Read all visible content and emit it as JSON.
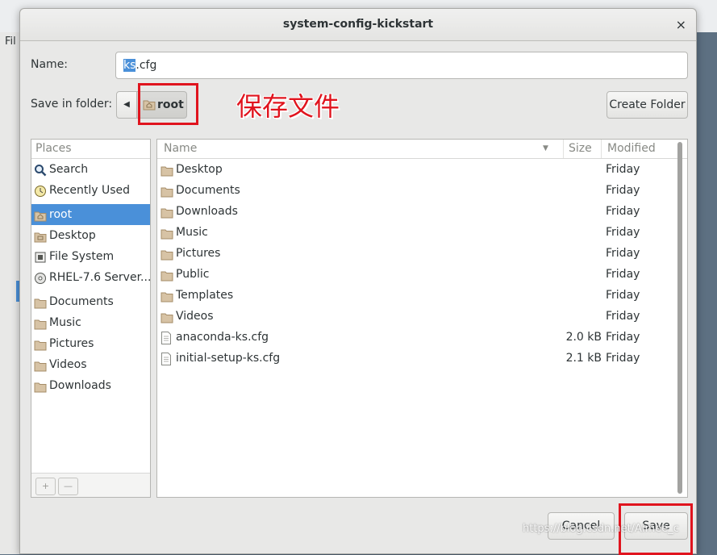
{
  "background": {
    "menu_text": "Fil"
  },
  "window": {
    "title": "system-config-kickstart",
    "close_glyph": "×"
  },
  "name_row": {
    "label": "Name:",
    "value_selected": "ks",
    "value_rest": ".cfg"
  },
  "folder_row": {
    "label": "Save in folder:",
    "back_glyph": "◀",
    "current": "root",
    "annotation": "保存文件",
    "create_folder": "Create Folder"
  },
  "places": {
    "header": "Places",
    "items": [
      {
        "label": "Search",
        "icon": "search-icon"
      },
      {
        "label": "Recently Used",
        "icon": "recent-icon"
      },
      {
        "label": "root",
        "icon": "home-folder-icon",
        "active": true
      },
      {
        "label": "Desktop",
        "icon": "folder-icon"
      },
      {
        "label": "File System",
        "icon": "drive-icon"
      },
      {
        "label": "RHEL-7.6 Server...",
        "icon": "disc-icon"
      },
      {
        "label": "Documents",
        "icon": "folder-icon"
      },
      {
        "label": "Music",
        "icon": "folder-icon"
      },
      {
        "label": "Pictures",
        "icon": "folder-icon"
      },
      {
        "label": "Videos",
        "icon": "folder-icon"
      },
      {
        "label": "Downloads",
        "icon": "folder-icon"
      }
    ],
    "add_glyph": "+",
    "remove_glyph": "—"
  },
  "files": {
    "headers": {
      "name": "Name",
      "size": "Size",
      "modified": "Modified"
    },
    "sort_glyph": "▼",
    "rows": [
      {
        "name": "Desktop",
        "size": "",
        "modified": "Friday",
        "type": "folder"
      },
      {
        "name": "Documents",
        "size": "",
        "modified": "Friday",
        "type": "folder"
      },
      {
        "name": "Downloads",
        "size": "",
        "modified": "Friday",
        "type": "folder"
      },
      {
        "name": "Music",
        "size": "",
        "modified": "Friday",
        "type": "folder"
      },
      {
        "name": "Pictures",
        "size": "",
        "modified": "Friday",
        "type": "folder"
      },
      {
        "name": "Public",
        "size": "",
        "modified": "Friday",
        "type": "folder"
      },
      {
        "name": "Templates",
        "size": "",
        "modified": "Friday",
        "type": "folder"
      },
      {
        "name": "Videos",
        "size": "",
        "modified": "Friday",
        "type": "folder"
      },
      {
        "name": "anaconda-ks.cfg",
        "size": "2.0 kB",
        "modified": "Friday",
        "type": "file"
      },
      {
        "name": "initial-setup-ks.cfg",
        "size": "2.1 kB",
        "modified": "Friday",
        "type": "file"
      }
    ]
  },
  "buttons": {
    "cancel": "Cancel",
    "save": "Save"
  },
  "watermark": "https://blog.csdn.net/Aimee_c",
  "colors": {
    "accent": "#4a90d9",
    "highlight": "#e0141e",
    "folder": "#d7c3a5"
  }
}
